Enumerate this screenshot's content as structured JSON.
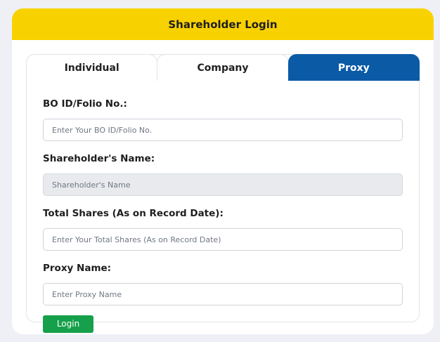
{
  "header": {
    "title": "Shareholder Login"
  },
  "tabs": [
    {
      "label": "Individual",
      "active": false
    },
    {
      "label": "Company",
      "active": false
    },
    {
      "label": "Proxy",
      "active": true
    }
  ],
  "form": {
    "fields": [
      {
        "label": "BO ID/Folio No.:",
        "placeholder": "Enter Your BO ID/Folio No.",
        "value": "",
        "disabled": false
      },
      {
        "label": "Shareholder's Name:",
        "placeholder": "Shareholder's Name",
        "value": "",
        "disabled": true
      },
      {
        "label": "Total Shares (As on Record Date):",
        "placeholder": "Enter Your Total Shares (As on Record Date)",
        "value": "",
        "disabled": false
      },
      {
        "label": "Proxy Name:",
        "placeholder": "Enter Proxy Name",
        "value": "",
        "disabled": false
      }
    ],
    "submit_label": "Login"
  },
  "colors": {
    "header_bg": "#f8d200",
    "active_tab_bg": "#0a5aa6",
    "login_button_bg": "#16a04b",
    "disabled_input_bg": "#e8eaed"
  }
}
